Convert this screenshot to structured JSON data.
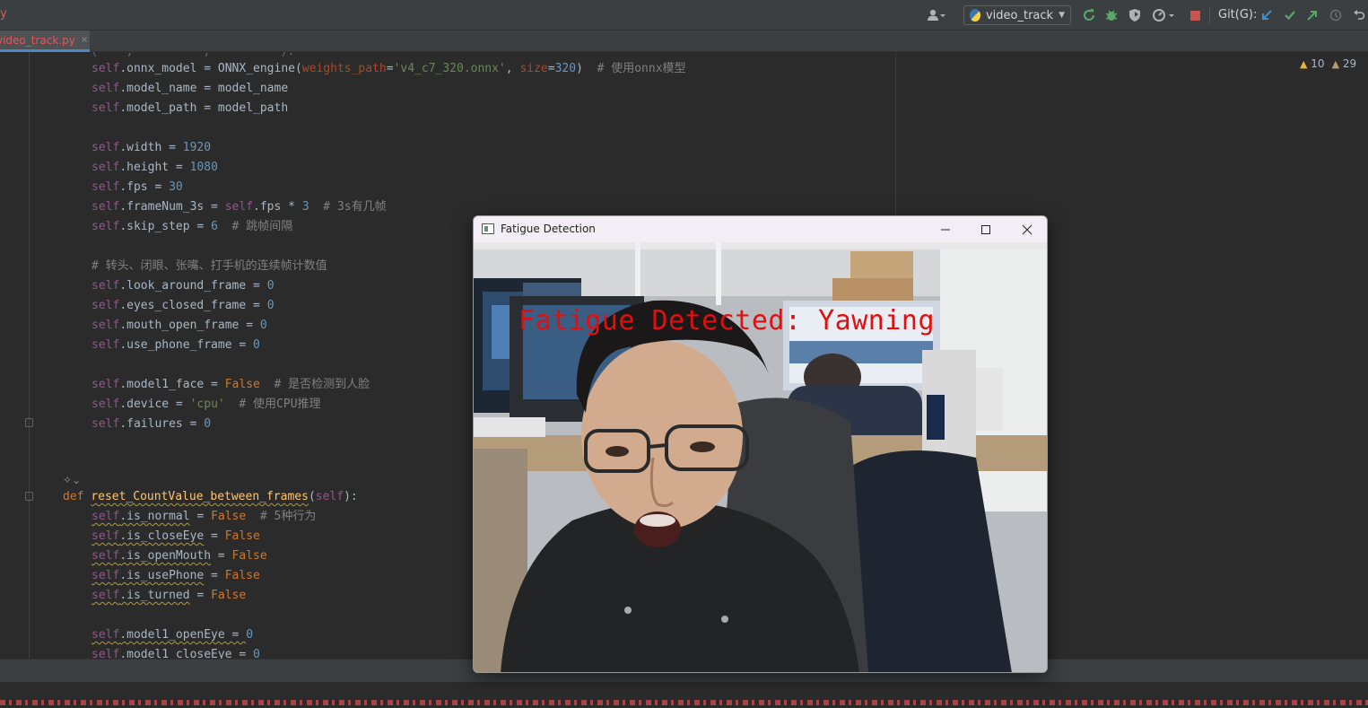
{
  "toolbar": {
    "left_fragment": "y",
    "run_config": "video_track",
    "git_label": "Git(G):"
  },
  "tab": {
    "label": "video_track.py",
    "close": "×"
  },
  "inspections": {
    "warnings": "10",
    "weak_warnings": "29"
  },
  "code": {
    "l0": "self.onnx_model = ONNX_engine(weights_path='v4_c7_320.onnx', size=320)  # 使用onnx模型",
    "l1_self": "self",
    "l1_rest": ".model_name = model_name",
    "l2_self": "self",
    "l2_rest": ".model_path = model_path",
    "l3_self": "self",
    "l3_mid": ".width = ",
    "l3_num": "1920",
    "l4_self": "self",
    "l4_mid": ".height = ",
    "l4_num": "1080",
    "l5_self": "self",
    "l5_mid": ".fps = ",
    "l5_num": "30",
    "l6_self": "self",
    "l6_mid": ".frameNum_3s = ",
    "l6_self2": "self",
    "l6_mid2": ".fps * ",
    "l6_num": "3",
    "l6_cmt": "  # 3s有几帧",
    "l7_self": "self",
    "l7_mid": ".skip_step = ",
    "l7_num": "6",
    "l7_cmt": "  # 跳帧间隔",
    "l8_cmt": "# 转头、闭眼、张嘴、打手机的连续帧计数值",
    "l9_self": "self",
    "l9_mid": ".look_around_frame = ",
    "l9_num": "0",
    "l10_self": "self",
    "l10_mid": ".eyes_closed_frame = ",
    "l10_num": "0",
    "l11_self": "self",
    "l11_mid": ".mouth_open_frame = ",
    "l11_num": "0",
    "l12_self": "self",
    "l12_mid": ".use_phone_frame = ",
    "l12_num": "0",
    "l13_self": "self",
    "l13_mid": ".model1_face = ",
    "l13_kw": "False",
    "l13_cmt": "  # 是否检测到人脸",
    "l14_self": "self",
    "l14_mid": ".device = ",
    "l14_str": "'cpu'",
    "l14_cmt": "  # 使用CPU推理",
    "l15_self": "self",
    "l15_mid": ".failures = ",
    "l15_num": "0",
    "l16_def": "def ",
    "l16_fn": "reset_CountValue_between_frames",
    "l16_open": "(",
    "l16_self": "self",
    "l16_close": "):",
    "l17_self": "self",
    "l17_mid": ".is_normal",
    "l17_eq": " = ",
    "l17_kw": "False",
    "l17_cmt": "  # 5种行为",
    "l18_self": "self",
    "l18_mid": ".is_closeEye",
    "l18_eq": " = ",
    "l18_kw": "False",
    "l19_self": "self",
    "l19_mid": ".is_openMouth",
    "l19_eq": " = ",
    "l19_kw": "False",
    "l20_self": "self",
    "l20_mid": ".is_usePhone",
    "l20_eq": " = ",
    "l20_kw": "False",
    "l21_self": "self",
    "l21_mid": ".is_turned",
    "l21_eq": " = ",
    "l21_kw": "False",
    "l22_self": "self",
    "l22_mid": ".model1_openEye = ",
    "l22_num": "0",
    "l23_self": "self",
    "l23_mid": ".model1_closeEye = ",
    "l23_num": "0"
  },
  "popup": {
    "title": "Fatigue Detection",
    "overlay": "Fatigue Detected: Yawning"
  },
  "colors": {
    "accent": "#4a88c7",
    "overlay_text": "#e30e0e"
  }
}
